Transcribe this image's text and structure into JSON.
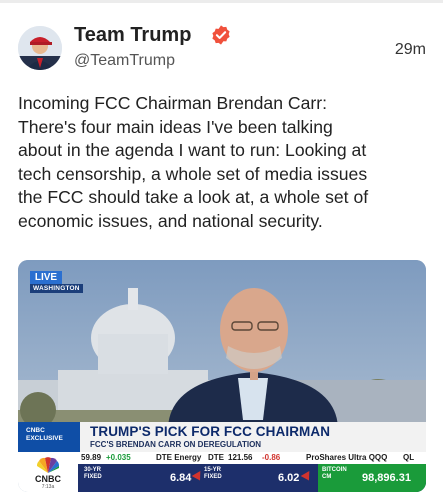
{
  "post": {
    "display_name": "Team Trump",
    "handle": "@TeamTrump",
    "timestamp": "29m",
    "text": "Incoming FCC Chairman Brendan Carr:\nThere's four main ideas I've been talking\nabout in the agenda I want to run: Looking at\ntech censorship, a whole set of media issues\nthe FCC should take a look at, a whole set of\neconomic issues, and national security."
  },
  "media": {
    "live_label": "LIVE",
    "location": "WASHINGTON",
    "exclusive_label_1": "CNBC",
    "exclusive_label_2": "EXCLUSIVE",
    "headline": "TRUMP'S PICK FOR FCC CHAIRMAN",
    "subheadline": "FCC'S BRENDAN CARR ON DEREGULATION",
    "ticker": {
      "item1_value": "59.89",
      "item1_change": "+0.035",
      "item2_name": "DTE Energy",
      "item2_symbol": "DTE",
      "item2_value": "121.56",
      "item2_change": "-0.86",
      "item3_name": "ProShares Ultra QQQ",
      "item3_symbol": "QL"
    },
    "network": "CNBC",
    "network_time": "7:13a",
    "rates": [
      {
        "label_1": "30-YR",
        "label_2": "FIXED",
        "value": "6.84"
      },
      {
        "label_1": "15-YR",
        "label_2": "FIXED",
        "value": "6.02"
      }
    ],
    "bitcoin": {
      "label_1": "BITCOIN",
      "label_2": "CM",
      "value": "98,896.31"
    }
  },
  "colors": {
    "verified": "#f0513c",
    "network_blue": "#1d2f6b",
    "headline_navy": "#0d2a6b",
    "bitcoin_green": "#1a9b3a"
  }
}
